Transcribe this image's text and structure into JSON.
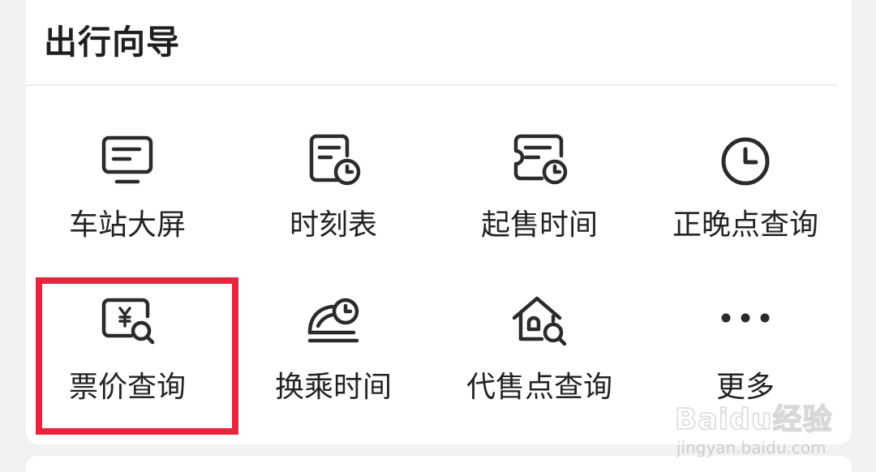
{
  "section": {
    "title": "出行向导"
  },
  "items": [
    {
      "label": "车站大屏",
      "icon": "monitor-icon"
    },
    {
      "label": "时刻表",
      "icon": "timetable-icon"
    },
    {
      "label": "起售时间",
      "icon": "ticket-clock-icon"
    },
    {
      "label": "正晚点查询",
      "icon": "clock-icon"
    },
    {
      "label": "票价查询",
      "icon": "ticket-price-search-icon"
    },
    {
      "label": "换乘时间",
      "icon": "train-clock-icon"
    },
    {
      "label": "代售点查询",
      "icon": "agency-search-icon"
    },
    {
      "label": "更多",
      "icon": "more-dots-icon"
    }
  ],
  "highlight_color": "#e8253f",
  "watermark": {
    "logo": "Baidu经验",
    "url": "jingyan.baidu.com"
  }
}
